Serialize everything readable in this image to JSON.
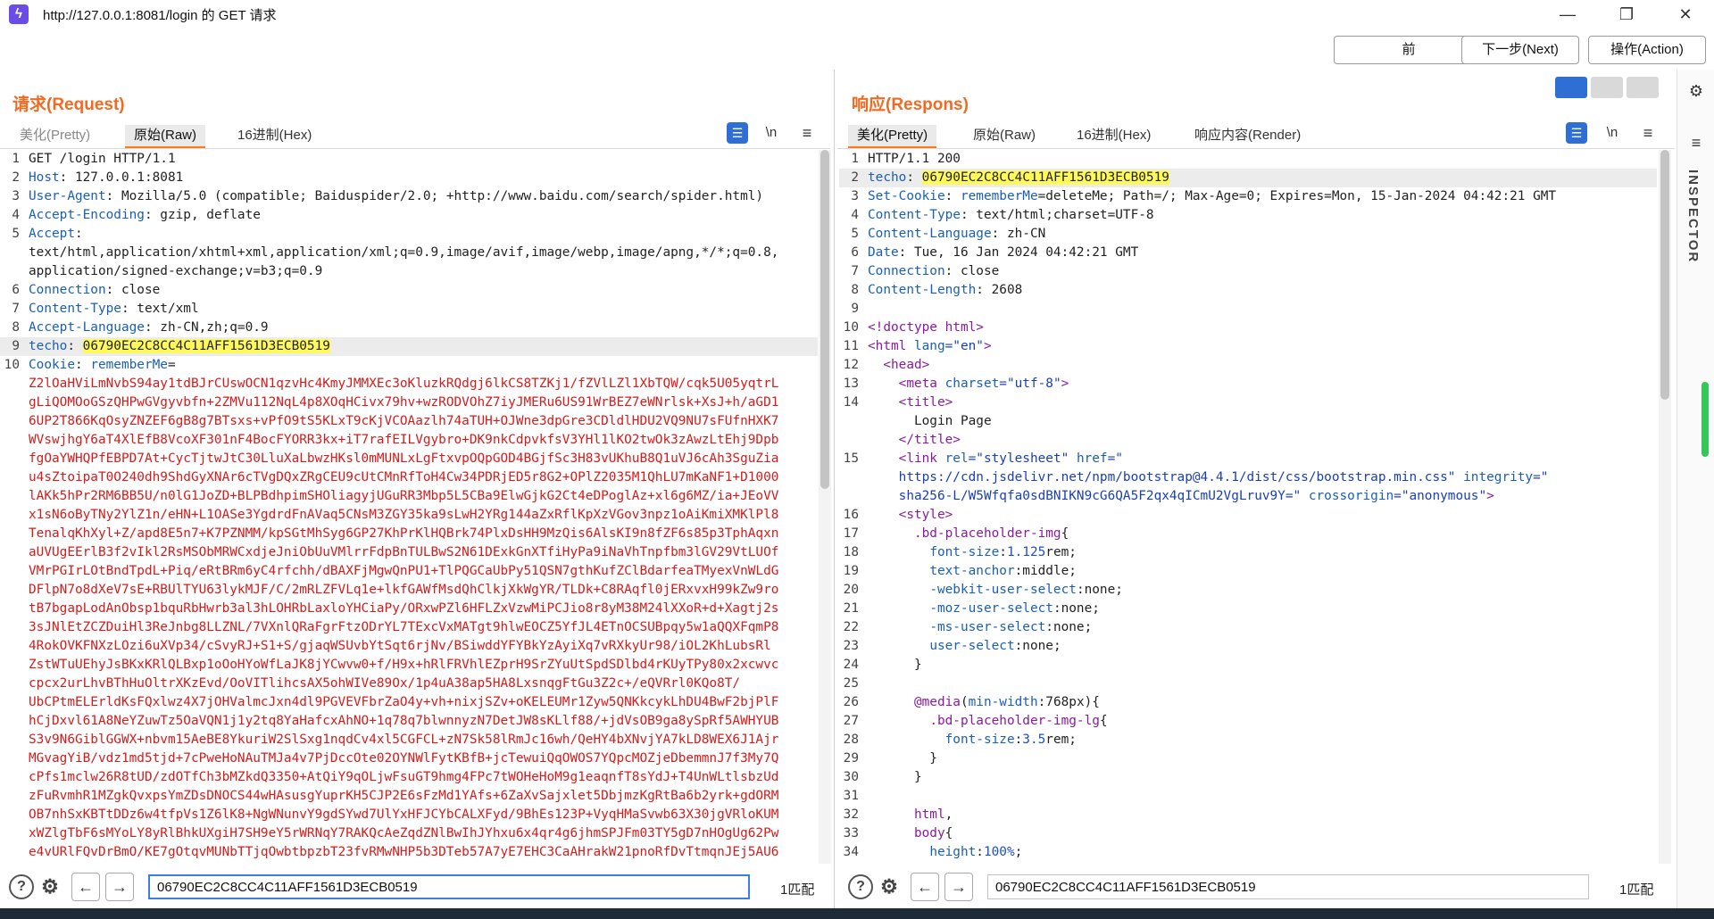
{
  "window": {
    "title": "http://127.0.0.1:8081/login 的 GET 请求"
  },
  "nav": {
    "prev": "前",
    "next": "下一步(Next)",
    "action": "操作(Action)"
  },
  "request": {
    "title": "请求(Request)",
    "tabs": [
      "美化(Pretty)",
      "原始(Raw)",
      "16进制(Hex)"
    ],
    "newline_label": "\\n",
    "lines": [
      {
        "n": "1",
        "parts": [
          {
            "t": "GET /login HTTP/1.1"
          }
        ]
      },
      {
        "n": "2",
        "parts": [
          {
            "t": "Host",
            "c": "hdr"
          },
          {
            "t": ": 127.0.0.1:8081"
          }
        ]
      },
      {
        "n": "3",
        "parts": [
          {
            "t": "User-Agent",
            "c": "hdr"
          },
          {
            "t": ": Mozilla/5.0 (compatible; Baiduspider/2.0; +http://www.baidu.com/search/spider.html)"
          }
        ]
      },
      {
        "n": "4",
        "parts": [
          {
            "t": "Accept-Encoding",
            "c": "hdr"
          },
          {
            "t": ": gzip, deflate"
          }
        ]
      },
      {
        "n": "5",
        "parts": [
          {
            "t": "Accept",
            "c": "hdr"
          },
          {
            "t": ":"
          }
        ]
      },
      {
        "n": "",
        "parts": [
          {
            "t": "text/html,application/xhtml+xml,application/xml;q=0.9,image/avif,image/webp,image/apng,*/*;q=0.8,"
          }
        ]
      },
      {
        "n": "",
        "parts": [
          {
            "t": "application/signed-exchange;v=b3;q=0.9"
          }
        ]
      },
      {
        "n": "6",
        "parts": [
          {
            "t": "Connection",
            "c": "hdr"
          },
          {
            "t": ": close"
          }
        ]
      },
      {
        "n": "7",
        "parts": [
          {
            "t": "Content-Type",
            "c": "hdr"
          },
          {
            "t": ": text/xml"
          }
        ]
      },
      {
        "n": "8",
        "parts": [
          {
            "t": "Accept-Language",
            "c": "hdr"
          },
          {
            "t": ": zh-CN,zh;q=0.9"
          }
        ]
      },
      {
        "n": "9",
        "hl": true,
        "parts": [
          {
            "t": "techo",
            "c": "hdr"
          },
          {
            "t": ": "
          },
          {
            "t": "06790EC2C8CC4C11AFF1561D3ECB0519",
            "c": "hlv"
          }
        ]
      },
      {
        "n": "10",
        "parts": [
          {
            "t": "Cookie",
            "c": "hdr"
          },
          {
            "t": ": "
          },
          {
            "t": "rememberMe",
            "c": "hdr"
          },
          {
            "t": "="
          }
        ]
      },
      {
        "n": "",
        "parts": [
          {
            "t": "Z2lOaHViLmNvbS94ay1tdBJrCUswOCN1qzvHc4KmyJMMXEc3oKluzkRQdgj6lkCS8TZKj1/fZVlLZl1XbTQW/cqk5U05yqtrL",
            "c": "red"
          }
        ]
      },
      {
        "n": "",
        "parts": [
          {
            "t": "gLiQOMOoGSzQHPwGVgyvbfn+2ZMVu112NqL4p8XOqHCivx79hv+wzRODVOhZ7iyJMERu6US91WrBEZ7eWNrlsk+XsJ+h/aGD1",
            "c": "red"
          }
        ]
      },
      {
        "n": "",
        "parts": [
          {
            "t": "6UP2T866KqOsyZNZEF6gB8g7BTsxs+vPfO9tS5KLxT9cKjVCOAazlh74aTUH+OJWne3dpGre3CDldlHDU2VQ9NU7sFUfnHXK7",
            "c": "red"
          }
        ]
      },
      {
        "n": "",
        "parts": [
          {
            "t": "WVswjhgY6aT4XlEfB8VcoXF301nF4BocFYORR3kx+iT7rafEILVgybro+DK9nkCdpvkfsV3YHl1lKO2twOk3zAwzLtEhj9Dpb",
            "c": "red"
          }
        ]
      },
      {
        "n": "",
        "parts": [
          {
            "t": "fgOaYWHQPfEBPD7At+CycTjtwJtC30LluXaLbwzHKsl0mMUNLxLgFtxvpOQpGOD4BGjfSc3H83vUKhuB8Q1uVJ6cAh3SguZia",
            "c": "red"
          }
        ]
      },
      {
        "n": "",
        "parts": [
          {
            "t": "u4sZtoipaT0O240dh9ShdGyXNAr6cTVgDQxZRgCEU9cUtCMnRfToH4Cw34PDRjED5r8G2+OPlZ2035M1QhLU7mKaNF1+D1000",
            "c": "red"
          }
        ]
      },
      {
        "n": "",
        "parts": [
          {
            "t": "lAKk5hPr2RM6BB5U/n0lG1JoZD+BLPBdhpimSHOliagyjUGuRR3Mbp5L5CBa9ElwGjkG2Ct4eDPoglAz+xl6g6MZ/ia+JEoVV",
            "c": "red"
          }
        ]
      },
      {
        "n": "",
        "parts": [
          {
            "t": "x1sN6oByTNy2YlZ1n/eHN+L1OASe3YgdrdFnAVaq5CNsM3ZGY35ka9sLwH2YRg144aZxRflKpXzVGov3npz1oAiKmiXMKlPl8",
            "c": "red"
          }
        ]
      },
      {
        "n": "",
        "parts": [
          {
            "t": "TenalqKhXyl+Z/apd8E5n7+K7PZNMM/kpSGtMhSyg6GP27KhPrKlHQBrk74PlxDsHH9MzQis6AlsKI9n8fZF6s85p3TphAqxn",
            "c": "red"
          }
        ]
      },
      {
        "n": "",
        "parts": [
          {
            "t": "aUVUgEErlB3f2vIkl2RsMSObMRWCxdjeJniObUuVMlrrFdpBnTULBwS2N61DExkGnXTfiHyPa9iNaVhTnpfbm3lGV29VtLUOf",
            "c": "red"
          }
        ]
      },
      {
        "n": "",
        "parts": [
          {
            "t": "VMrPGIrLOtBndTpdL+Piq/eRtBRm6yC4rfchh/dBAXFjMgwQnPU1+TlPQGCaUbPy51QSN7gthKufZClBdarfeaTMyexVnWLdG",
            "c": "red"
          }
        ]
      },
      {
        "n": "",
        "parts": [
          {
            "t": "DFlpN7o8dXeV7sE+RBUlTYU63lykMJF/C/2mRLZFVLq1e+lkfGAWfMsdQhClkjXkWgYR/TLDk+C8RAqfl0jERxvxH99kZw9ro",
            "c": "red"
          }
        ]
      },
      {
        "n": "",
        "parts": [
          {
            "t": "tB7bgapLodAnObsp1bquRbHwrb3al3hLOHRbLaxloYHCiaPy/ORxwPZl6HFLZxVzwMiPCJio8r8yM38M24lXXoR+d+Xagtj2s",
            "c": "red"
          }
        ]
      },
      {
        "n": "",
        "parts": [
          {
            "t": "3sJNlEtZCZDuiHl3ReJnbg8LLZNL/7VXnlQRaFgrFtzODrYL7TExcVxMATgt9hlwEOCZ5YfJL4ETnOCSUBpqy5w1aQQXFqmP8",
            "c": "red"
          }
        ]
      },
      {
        "n": "",
        "parts": [
          {
            "t": "4RokOVKFNXzLOzi6uXVp34/cSvyRJ+S1+S/gjaqWSUvbYtSqt6rjNv/BSiwddYFYBkYzAyiXq7vRXkyUr98/iOL2KhLubsRl",
            "c": "red"
          }
        ]
      },
      {
        "n": "",
        "parts": [
          {
            "t": "ZstWTuUEhyJsBKxKRlQLBxp1oOoHYoWfLaJK8jYCwvw0+f/H9x+hRlFRVhlEZprH9SrZYuUtSpdSDlbd4rKUyTPy80x2xcwvc",
            "c": "red"
          }
        ]
      },
      {
        "n": "",
        "parts": [
          {
            "t": "cpcx2urLhvBThHuOltrXKzEvd/OoVITlihcsAX5ohWIVe89Ox/1p4uA38ap5HA8LxsnqgFtGu3Z2c+/eQVRrl0KQo8T/",
            "c": "red"
          }
        ]
      },
      {
        "n": "",
        "parts": [
          {
            "t": "UbCPtmELErldKsFQxlwz4X7jOHValmcJxn4dl9PGVEVFbrZaO4y+vh+nixjSZv+oKELEUMr1Zyw5QNKkcykLhDU4BwF2bjPlF",
            "c": "red"
          }
        ]
      },
      {
        "n": "",
        "parts": [
          {
            "t": "hCjDxvl61A8NeYZuwTz5OaVQN1j1y2tq8YaHafcxAhNO+1q78q7blwnnyzN7DetJW8sKLlf88/+jdVsOB9ga8ySpRf5AWHYUB",
            "c": "red"
          }
        ]
      },
      {
        "n": "",
        "parts": [
          {
            "t": "S3v9N6GiblGGWX+nbvm15AeBE8YkuriW2SlSxg1nqdCv4xl5CGFCL+zN7Sk58lRmJc16wh/QeHY4bXNvjYA7kLD8WEX6J1Ajr",
            "c": "red"
          }
        ]
      },
      {
        "n": "",
        "parts": [
          {
            "t": "MGvagYiB/vdz1md5tjd+7cPweHoNAuTMJa4v7PjDccOte02OYNWlFytKBfB+jcTewuiQqOWOS7YQpcMOZjeDbemmnJ7f3My7Q",
            "c": "red"
          }
        ]
      },
      {
        "n": "",
        "parts": [
          {
            "t": "cPfs1mclw26R8tUD/zdOTfCh3bMZkdQ3350+AtQiY9qOLjwFsuGT9hmg4FPc7tWOHeHoM9g1eaqnfT8sYdJ+T4UnWLtlsbzUd",
            "c": "red"
          }
        ]
      },
      {
        "n": "",
        "parts": [
          {
            "t": "zFuRvmhR1MZgkQvxpsYmZDsDNOCS44wHAsusgYuprKH5CJP2E6sFzMd1YAfs+6ZaXvSajxlet5DbjmzKgRtBa6b2yrk+gdORM",
            "c": "red"
          }
        ]
      },
      {
        "n": "",
        "parts": [
          {
            "t": "OB7nhSxKBTtDDz6w4tfpVs1Z6lK8+NgWNunvY9gdSYwd7UlYxHFJCYbCALXFyd/9BhEs123P+VyqHMaSvwb63X30jgVRloKUM",
            "c": "red"
          }
        ]
      },
      {
        "n": "",
        "parts": [
          {
            "t": "xWZlgTbF6sMYoLY8yRlBhkUXgiH7SH9eY5rWRNqY7RAKQcAeZqdZNlBwIhJYhxu6x4qr4g6jhmSPJFm03TY5gD7nHOgUg62Pw",
            "c": "red"
          }
        ]
      },
      {
        "n": "",
        "parts": [
          {
            "t": "e4vURlFQvDrBmO/KE7gOtqvMUNbTTjqOwbtbpzbT23fvRMwNHP5b3DTeb57A7yE7EHC3CaAHrakW21pnoRfDvTtmqnJEj5AU6",
            "c": "red"
          }
        ]
      }
    ],
    "search_value": "06790EC2C8CC4C11AFF1561D3ECB0519",
    "match": "1匹配"
  },
  "response": {
    "title": "响应(Respons)",
    "tabs": [
      "美化(Pretty)",
      "原始(Raw)",
      "16进制(Hex)",
      "响应内容(Render)"
    ],
    "newline_label": "\\n",
    "lines": [
      {
        "n": "1",
        "parts": [
          {
            "t": "HTTP/1.1 200"
          }
        ]
      },
      {
        "n": "2",
        "hl": true,
        "parts": [
          {
            "t": "techo",
            "c": "hdr"
          },
          {
            "t": ": "
          },
          {
            "t": "06790EC2C8CC4C11AFF1561D3ECB0519",
            "c": "hlv"
          }
        ]
      },
      {
        "n": "3",
        "parts": [
          {
            "t": "Set-Cookie",
            "c": "hdr"
          },
          {
            "t": ": "
          },
          {
            "t": "rememberMe",
            "c": "hdr"
          },
          {
            "t": "=deleteMe; Path=/; Max-Age=0; Expires=Mon, 15-Jan-2024 04:42:21 GMT"
          }
        ]
      },
      {
        "n": "4",
        "parts": [
          {
            "t": "Content-Type",
            "c": "hdr"
          },
          {
            "t": ": text/html;charset=UTF-8"
          }
        ]
      },
      {
        "n": "5",
        "parts": [
          {
            "t": "Content-Language",
            "c": "hdr"
          },
          {
            "t": ": zh-CN"
          }
        ]
      },
      {
        "n": "6",
        "parts": [
          {
            "t": "Date",
            "c": "hdr"
          },
          {
            "t": ": Tue, 16 Jan 2024 04:42:21 GMT"
          }
        ]
      },
      {
        "n": "7",
        "parts": [
          {
            "t": "Connection",
            "c": "hdr"
          },
          {
            "t": ": close"
          }
        ]
      },
      {
        "n": "8",
        "parts": [
          {
            "t": "Content-Length",
            "c": "hdr"
          },
          {
            "t": ": 2608"
          }
        ]
      },
      {
        "n": "9",
        "parts": [
          {
            "t": ""
          }
        ]
      },
      {
        "n": "10",
        "parts": [
          {
            "t": "<!doctype html>",
            "c": "tag"
          }
        ]
      },
      {
        "n": "11",
        "parts": [
          {
            "t": "<html ",
            "c": "tag"
          },
          {
            "t": "lang",
            "c": "attr"
          },
          {
            "t": "=\"en\"",
            "c": "aval"
          },
          {
            "t": ">",
            "c": "tag"
          }
        ]
      },
      {
        "n": "12",
        "parts": [
          {
            "t": "  "
          },
          {
            "t": "<head>",
            "c": "tag"
          }
        ]
      },
      {
        "n": "13",
        "parts": [
          {
            "t": "    "
          },
          {
            "t": "<meta ",
            "c": "tag"
          },
          {
            "t": "charset",
            "c": "attr"
          },
          {
            "t": "=\"utf-8\"",
            "c": "aval"
          },
          {
            "t": ">",
            "c": "tag"
          }
        ]
      },
      {
        "n": "14",
        "parts": [
          {
            "t": "    "
          },
          {
            "t": "<title>",
            "c": "tag"
          }
        ]
      },
      {
        "n": "",
        "parts": [
          {
            "t": "      Login Page"
          }
        ]
      },
      {
        "n": "",
        "parts": [
          {
            "t": "    "
          },
          {
            "t": "</title>",
            "c": "tag"
          }
        ]
      },
      {
        "n": "15",
        "parts": [
          {
            "t": "    "
          },
          {
            "t": "<link ",
            "c": "tag"
          },
          {
            "t": "rel",
            "c": "attr"
          },
          {
            "t": "=\"stylesheet\" ",
            "c": "aval"
          },
          {
            "t": "href",
            "c": "attr"
          },
          {
            "t": "=\"",
            "c": "aval"
          }
        ]
      },
      {
        "n": "",
        "parts": [
          {
            "t": "    https://cdn.jsdelivr.net/npm/bootstrap@4.4.1/dist/css/bootstrap.min.css\" ",
            "c": "aval"
          },
          {
            "t": "integrity",
            "c": "attr"
          },
          {
            "t": "=\"",
            "c": "aval"
          }
        ]
      },
      {
        "n": "",
        "parts": [
          {
            "t": "    sha256-L/W5Wfqfa0sdBNIKN9cG6QA5F2qx4qICmU2VgLruv9Y=\" ",
            "c": "aval"
          },
          {
            "t": "crossorigin",
            "c": "attr"
          },
          {
            "t": "=\"anonymous\"",
            "c": "aval"
          },
          {
            "t": ">",
            "c": "tag"
          }
        ]
      },
      {
        "n": "16",
        "parts": [
          {
            "t": "    "
          },
          {
            "t": "<style>",
            "c": "tag"
          }
        ]
      },
      {
        "n": "17",
        "parts": [
          {
            "t": "      "
          },
          {
            "t": ".bd-placeholder-img",
            "c": "css-sel"
          },
          {
            "t": "{"
          }
        ]
      },
      {
        "n": "18",
        "parts": [
          {
            "t": "        "
          },
          {
            "t": "font-size",
            "c": "css-prop"
          },
          {
            "t": ":"
          },
          {
            "t": "1.125",
            "c": "css-num"
          },
          {
            "t": "rem;"
          }
        ]
      },
      {
        "n": "19",
        "parts": [
          {
            "t": "        "
          },
          {
            "t": "text-anchor",
            "c": "css-prop"
          },
          {
            "t": ":middle;"
          }
        ]
      },
      {
        "n": "20",
        "parts": [
          {
            "t": "        "
          },
          {
            "t": "-webkit-user-select",
            "c": "css-prop"
          },
          {
            "t": ":none;"
          }
        ]
      },
      {
        "n": "21",
        "parts": [
          {
            "t": "        "
          },
          {
            "t": "-moz-user-select",
            "c": "css-prop"
          },
          {
            "t": ":none;"
          }
        ]
      },
      {
        "n": "22",
        "parts": [
          {
            "t": "        "
          },
          {
            "t": "-ms-user-select",
            "c": "css-prop"
          },
          {
            "t": ":none;"
          }
        ]
      },
      {
        "n": "23",
        "parts": [
          {
            "t": "        "
          },
          {
            "t": "user-select",
            "c": "css-prop"
          },
          {
            "t": ":none;"
          }
        ]
      },
      {
        "n": "24",
        "parts": [
          {
            "t": "      }"
          }
        ]
      },
      {
        "n": "25",
        "parts": [
          {
            "t": ""
          }
        ]
      },
      {
        "n": "26",
        "parts": [
          {
            "t": "      "
          },
          {
            "t": "@media",
            "c": "css-sel"
          },
          {
            "t": "("
          },
          {
            "t": "min-width",
            "c": "css-prop"
          },
          {
            "t": ":768px){"
          }
        ]
      },
      {
        "n": "27",
        "parts": [
          {
            "t": "        "
          },
          {
            "t": ".bd-placeholder-img-lg",
            "c": "css-sel"
          },
          {
            "t": "{"
          }
        ]
      },
      {
        "n": "28",
        "parts": [
          {
            "t": "          "
          },
          {
            "t": "font-size",
            "c": "css-prop"
          },
          {
            "t": ":"
          },
          {
            "t": "3.5",
            "c": "css-num"
          },
          {
            "t": "rem;"
          }
        ]
      },
      {
        "n": "29",
        "parts": [
          {
            "t": "        }"
          }
        ]
      },
      {
        "n": "30",
        "parts": [
          {
            "t": "      }"
          }
        ]
      },
      {
        "n": "31",
        "parts": [
          {
            "t": ""
          }
        ]
      },
      {
        "n": "32",
        "parts": [
          {
            "t": "      "
          },
          {
            "t": "html",
            "c": "css-sel"
          },
          {
            "t": ","
          }
        ]
      },
      {
        "n": "33",
        "parts": [
          {
            "t": "      "
          },
          {
            "t": "body",
            "c": "css-sel"
          },
          {
            "t": "{"
          }
        ]
      },
      {
        "n": "34",
        "parts": [
          {
            "t": "        "
          },
          {
            "t": "height",
            "c": "css-prop"
          },
          {
            "t": ":"
          },
          {
            "t": "100%",
            "c": "css-num"
          },
          {
            "t": ";"
          }
        ]
      }
    ],
    "search_value": "06790EC2C8CC4C11AFF1561D3ECB0519",
    "match": "1匹配"
  },
  "side": {
    "inspector_label": "INSPECTOR"
  },
  "colors": {
    "accent": "#f26a21",
    "highlight": "#fff95c",
    "header_key": "#1a5fb4",
    "cookie_value": "#d41c1c",
    "active_blue": "#2f6fd3"
  },
  "icons": [
    "help-icon",
    "settings-icon",
    "arrow-left-icon",
    "arrow-right-icon",
    "wrap-lines-icon",
    "menu-icon",
    "minimize-icon",
    "maximize-icon",
    "close-icon",
    "layout-split-icon",
    "layout-rows-icon",
    "layout-single-icon"
  ]
}
